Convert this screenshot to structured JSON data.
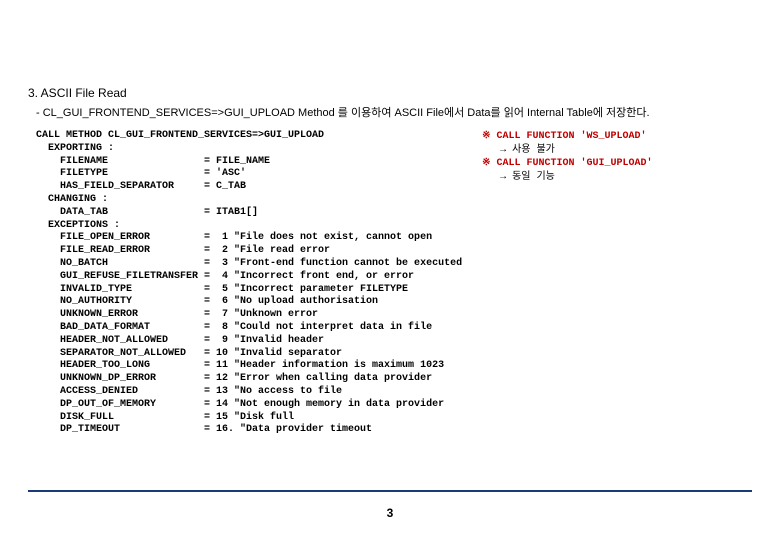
{
  "section": {
    "title": "3. ASCII File Read",
    "desc": "- CL_GUI_FRONTEND_SERVICES=>GUI_UPLOAD Method 를 이용하여 ASCII File에서 Data를 읽어 Internal Table에 저장한다."
  },
  "code": {
    "call_line": "CALL METHOD CL_GUI_FRONTEND_SERVICES=>GUI_UPLOAD",
    "exporting_kw": "  EXPORTING :",
    "exporting": [
      {
        "name": "FILENAME",
        "val": "FILE_NAME"
      },
      {
        "name": "FILETYPE",
        "val": "'ASC'"
      },
      {
        "name": "HAS_FIELD_SEPARATOR",
        "val": "C_TAB"
      }
    ],
    "changing_kw": "  CHANGING :",
    "changing": [
      {
        "name": "DATA_TAB",
        "val": "ITAB1[]"
      }
    ],
    "exceptions_kw": "  EXCEPTIONS :",
    "exceptions": [
      {
        "name": "FILE_OPEN_ERROR",
        "num": "1",
        "msg": "\"File does not exist, cannot open"
      },
      {
        "name": "FILE_READ_ERROR",
        "num": "2",
        "msg": "\"File read error"
      },
      {
        "name": "NO_BATCH",
        "num": "3",
        "msg": "\"Front-end function cannot be executed"
      },
      {
        "name": "GUI_REFUSE_FILETRANSFER",
        "num": "4",
        "msg": "\"Incorrect front end, or error"
      },
      {
        "name": "INVALID_TYPE",
        "num": "5",
        "msg": "\"Incorrect parameter FILETYPE"
      },
      {
        "name": "NO_AUTHORITY",
        "num": "6",
        "msg": "\"No upload authorisation"
      },
      {
        "name": "UNKNOWN_ERROR",
        "num": "7",
        "msg": "\"Unknown error"
      },
      {
        "name": "BAD_DATA_FORMAT",
        "num": "8",
        "msg": "\"Could not interpret data in file"
      },
      {
        "name": "HEADER_NOT_ALLOWED",
        "num": "9",
        "msg": "\"Invalid header"
      },
      {
        "name": "SEPARATOR_NOT_ALLOWED",
        "num": "10",
        "msg": "\"Invalid separator"
      },
      {
        "name": "HEADER_TOO_LONG",
        "num": "11",
        "msg": "\"Header information is maximum 1023"
      },
      {
        "name": "UNKNOWN_DP_ERROR",
        "num": "12",
        "msg": "\"Error when calling data provider"
      },
      {
        "name": "ACCESS_DENIED",
        "num": "13",
        "msg": "\"No access to file"
      },
      {
        "name": "DP_OUT_OF_MEMORY",
        "num": "14",
        "msg": "\"Not enough memory in data provider"
      },
      {
        "name": "DISK_FULL",
        "num": "15",
        "msg": "\"Disk full"
      },
      {
        "name": "DP_TIMEOUT",
        "num": "16.",
        "msg": "\"Data provider timeout"
      }
    ]
  },
  "side": {
    "l1_sym": "※ ",
    "l1_kw": "CALL FUNCTION",
    "l1_fn": " 'WS_UPLOAD'",
    "l1_note": "   → 사용 불가",
    "l2_sym": "※ ",
    "l2_kw": "CALL FUNCTION",
    "l2_fn": " 'GUI_UPLOAD'",
    "l2_note": "   → 동일 기능"
  },
  "page_number": "3"
}
